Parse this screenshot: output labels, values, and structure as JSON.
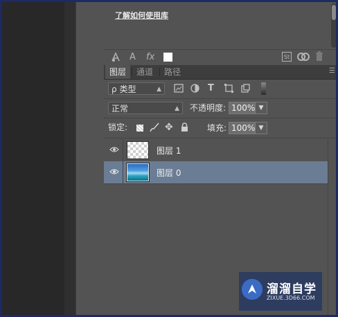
{
  "libraries": {
    "link_text": "了解如何使用库"
  },
  "library_toolbar": {
    "icons": [
      "add-character-style-icon",
      "text-style-icon",
      "fx-icon",
      "color-swatch-icon",
      "stock-icon",
      "cc-sync-icon",
      "trash-icon"
    ],
    "stock_label": "St",
    "char_label": "A",
    "fx_label": "fx"
  },
  "tabs": [
    {
      "label": "图层",
      "active": true
    },
    {
      "label": "通道",
      "active": false
    },
    {
      "label": "路径",
      "active": false
    }
  ],
  "filter": {
    "kind_label": "类型",
    "kind_prefix": "ρ"
  },
  "blend": {
    "mode": "正常",
    "opacity_label": "不透明度:",
    "opacity_value": "100%"
  },
  "lock": {
    "label": "锁定:",
    "fill_label": "填充:",
    "fill_value": "100%"
  },
  "layers": [
    {
      "name": "图层 1",
      "selected": false,
      "thumb": "transparent"
    },
    {
      "name": "图层 0",
      "selected": true,
      "thumb": "image"
    }
  ],
  "watermark": {
    "title": "溜溜自学",
    "url": "ZIXUE.3D66.COM"
  },
  "colors": {
    "selection": "#6a7d94",
    "panel_bg": "#535353",
    "tab_bar": "#3d3d3d",
    "frame": "#1f2a63"
  }
}
